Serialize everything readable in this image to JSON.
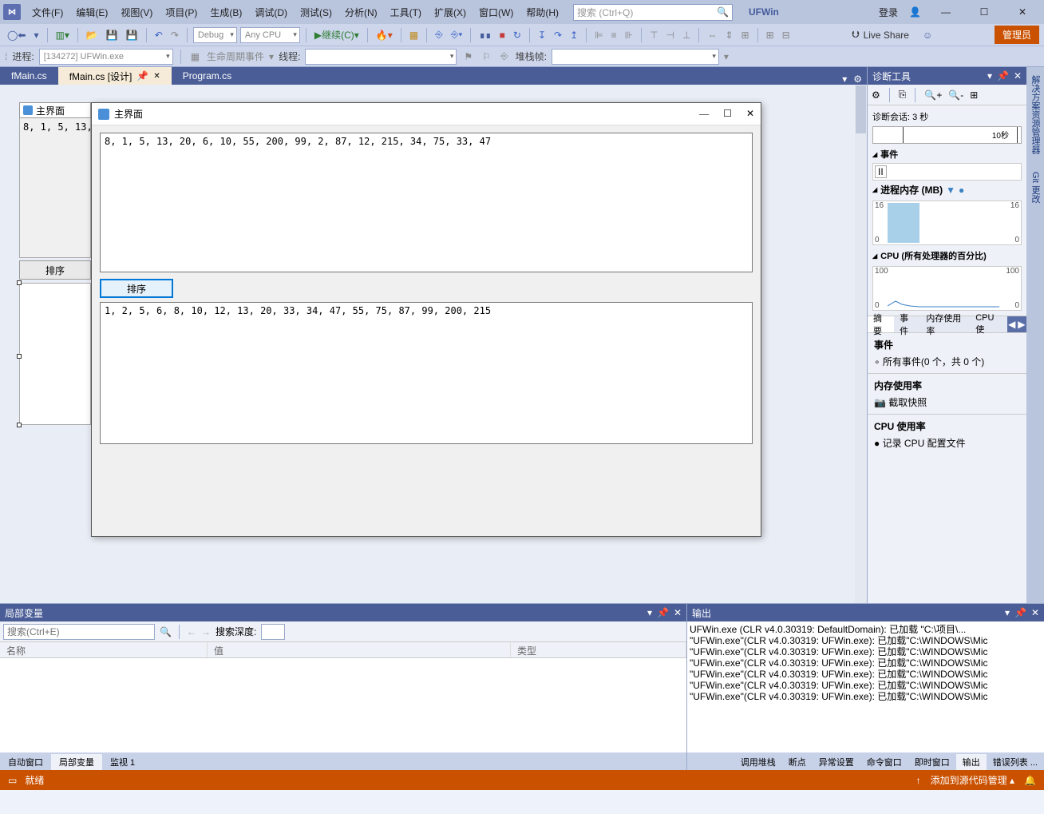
{
  "menu": [
    "文件(F)",
    "编辑(E)",
    "视图(V)",
    "项目(P)",
    "生成(B)",
    "调试(D)",
    "测试(S)",
    "分析(N)",
    "工具(T)",
    "扩展(X)",
    "窗口(W)",
    "帮助(H)"
  ],
  "search_placeholder": "搜索 (Ctrl+Q)",
  "app_name": "UFWin",
  "login": "登录",
  "admin_btn": "管理员",
  "toolbar": {
    "config": "Debug",
    "platform": "Any CPU",
    "continue": "继续(C)",
    "liveshare": "Live Share"
  },
  "proc": {
    "label": "进程:",
    "value": "[134272] UFWin.exe",
    "lifecycle": "生命周期事件",
    "thread": "线程:",
    "stackframe": "堆栈帧:"
  },
  "tabs": [
    {
      "label": "fMain.cs",
      "active": false
    },
    {
      "label": "fMain.cs [设计]",
      "active": true,
      "pin": true
    },
    {
      "label": "Program.cs",
      "active": false
    }
  ],
  "designer": {
    "bg_title": "主界面",
    "bg_text": "8, 1, 5, 13, 20",
    "bg_btn": "排序"
  },
  "run_window": {
    "title": "主界面",
    "text1": "8, 1, 5, 13, 20, 6, 10, 55, 200, 99, 2, 87, 12, 215, 34, 75, 33, 47",
    "btn": "排序",
    "text2": "1, 2, 5, 6, 8, 10, 12, 13, 20, 33, 34, 47, 55, 75, 87, 99, 200, 215"
  },
  "diag": {
    "title": "诊断工具",
    "session": "诊断会话: 3 秒",
    "timeline_tick": "10秒",
    "events": "事件",
    "pause": "II",
    "mem_header": "进程内存 (MB)",
    "mem_max": "16",
    "mem_min": "0",
    "cpu_header": "CPU (所有处理器的百分比)",
    "cpu_max": "100",
    "cpu_min": "0",
    "tabs": [
      "摘要",
      "事件",
      "内存使用率",
      "CPU 使"
    ],
    "sect_events": "事件",
    "sect_events_body": "所有事件(0 个，共 0 个)",
    "sect_mem": "内存使用率",
    "sect_mem_body": "截取快照",
    "sect_cpu": "CPU 使用率",
    "sect_cpu_body": "记录 CPU 配置文件"
  },
  "side_tabs": [
    "解决方案资源管理器",
    "Git 更改"
  ],
  "locals": {
    "title": "局部变量",
    "search_ph": "搜索(Ctrl+E)",
    "depth_lbl": "搜索深度:",
    "cols": [
      "名称",
      "值",
      "类型"
    ],
    "btabs": [
      "自动窗口",
      "局部变量",
      "监视 1"
    ]
  },
  "output": {
    "title": "输出",
    "lines": [
      "  UFWin.exe (CLR v4.0.30319: DefaultDomain): 已加载 \"C:\\项目\\...",
      "\"UFWin.exe\"(CLR v4.0.30319: UFWin.exe): 已加载\"C:\\WINDOWS\\Mic",
      "\"UFWin.exe\"(CLR v4.0.30319: UFWin.exe): 已加载\"C:\\WINDOWS\\Mic",
      "\"UFWin.exe\"(CLR v4.0.30319: UFWin.exe): 已加载\"C:\\WINDOWS\\Mic",
      "\"UFWin.exe\"(CLR v4.0.30319: UFWin.exe): 已加载\"C:\\WINDOWS\\Mic",
      "\"UFWin.exe\"(CLR v4.0.30319: UFWin.exe): 已加载\"C:\\WINDOWS\\Mic",
      "\"UFWin.exe\"(CLR v4.0.30319: UFWin.exe): 已加载\"C:\\WINDOWS\\Mic"
    ],
    "btabs": [
      "调用堆栈",
      "断点",
      "异常设置",
      "命令窗口",
      "即时窗口",
      "输出",
      "错误列表 ..."
    ]
  },
  "status": {
    "ready": "就绪",
    "add_src": "添加到源代码管理"
  }
}
